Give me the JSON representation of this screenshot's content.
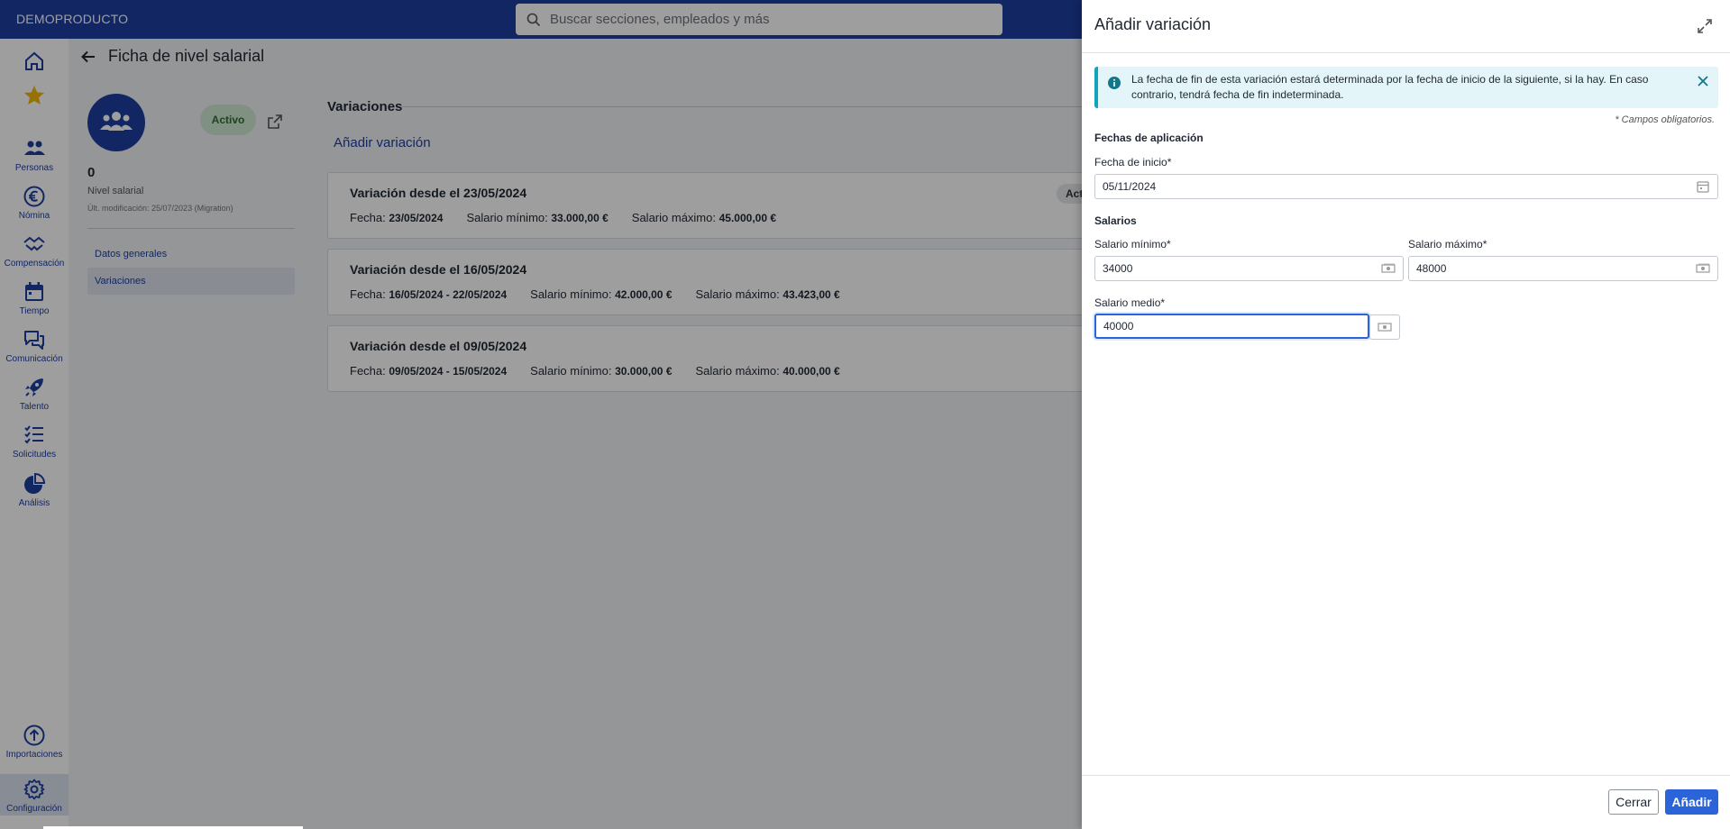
{
  "app": {
    "brand": "DEMOPRODUCTO",
    "search_placeholder": "Buscar secciones, empleados y más",
    "colors": {
      "primary": "#1d3ea1",
      "accent": "#2b63d9",
      "favorite": "#f2b705",
      "active_badge": "#cfe8d2"
    }
  },
  "sidebar": {
    "items": [
      {
        "label": "",
        "icon": "home-icon"
      },
      {
        "label": "",
        "icon": "star-icon"
      },
      {
        "label": "Personas",
        "icon": "people-icon"
      },
      {
        "label": "Nómina",
        "icon": "euro-icon"
      },
      {
        "label": "Compensación",
        "icon": "handshake-icon"
      },
      {
        "label": "Tiempo",
        "icon": "calendar-icon"
      },
      {
        "label": "Comunicación",
        "icon": "chat-icon"
      },
      {
        "label": "Talento",
        "icon": "rocket-icon"
      },
      {
        "label": "Solicitudes",
        "icon": "checklist-icon"
      },
      {
        "label": "Análisis",
        "icon": "pie-chart-icon"
      },
      {
        "label": "Importaciones",
        "icon": "upload-icon"
      },
      {
        "label": "Configuración",
        "icon": "gear-icon"
      }
    ]
  },
  "page": {
    "title": "Ficha de nivel salarial",
    "status_badge": "Activo",
    "level_number": "0",
    "level_label": "Nivel salarial",
    "last_modified": "Últ. modificación: 25/07/2023 (Migration)",
    "tabs": [
      {
        "label": "Datos generales"
      },
      {
        "label": "Variaciones"
      }
    ]
  },
  "variations": {
    "header": "Variaciones",
    "add_link": "Añadir variación",
    "cards": [
      {
        "title": "Variación desde el 23/05/2024",
        "fecha_label": "Fecha:",
        "fecha": "23/05/2024",
        "min_label": "Salario mínimo:",
        "min": "33.000,00 €",
        "max_label": "Salario máximo:",
        "max": "45.000,00 €",
        "status": "Activo"
      },
      {
        "title": "Variación desde el 16/05/2024",
        "fecha_label": "Fecha:",
        "fecha": "16/05/2024 - 22/05/2024",
        "min_label": "Salario mínimo:",
        "min": "42.000,00 €",
        "max_label": "Salario máximo:",
        "max": "43.423,00 €"
      },
      {
        "title": "Variación desde el 09/05/2024",
        "fecha_label": "Fecha:",
        "fecha": "09/05/2024 - 15/05/2024",
        "min_label": "Salario mínimo:",
        "min": "30.000,00 €",
        "max_label": "Salario máximo:",
        "max": "40.000,00 €"
      }
    ]
  },
  "drawer": {
    "title": "Añadir variación",
    "info_text": "La fecha de fin de esta variación estará determinada por la fecha de inicio de la siguiente, si la hay. En caso contrario, tendrá fecha de fin indeterminada.",
    "required_note": "* Campos obligatorios.",
    "section_dates": "Fechas de aplicación",
    "start_date_label": "Fecha de inicio*",
    "start_date_value": "05/11/2024",
    "section_salaries": "Salarios",
    "min_label": "Salario mínimo*",
    "min_value": "34000",
    "max_label": "Salario máximo*",
    "max_value": "48000",
    "avg_label": "Salario medio*",
    "avg_value": "40000",
    "close_button": "Cerrar",
    "add_button": "Añadir"
  }
}
